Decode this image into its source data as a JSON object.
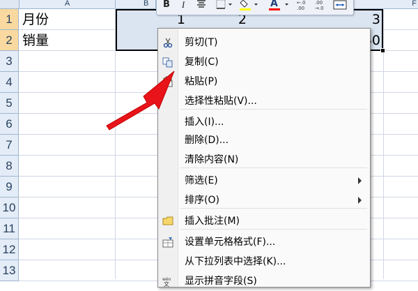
{
  "columns": [
    "A",
    "B",
    "F"
  ],
  "rows": [
    "1",
    "2",
    "3",
    "4",
    "5",
    "6",
    "7",
    "8",
    "9",
    "10",
    "11",
    "12",
    "13"
  ],
  "cells": {
    "a1": "月份",
    "a2": "销量",
    "b1": "1",
    "c1": "2",
    "f1": "3",
    "f2": "60"
  },
  "mini_toolbar": {
    "bold": "B",
    "italic": "I",
    "font_color_letter": "A",
    "fill_color": "#ffff00",
    "font_color": "#ff0000"
  },
  "context_menu": {
    "items": [
      {
        "label": "剪切(T)",
        "icon": "scissors-icon"
      },
      {
        "label": "复制(C)",
        "icon": "copy-icon"
      },
      {
        "label": "粘贴(P)",
        "icon": "paste-icon"
      },
      {
        "label": "选择性粘贴(V)...",
        "icon": ""
      },
      {
        "label": "插入(I)...",
        "icon": ""
      },
      {
        "label": "删除(D)...",
        "icon": ""
      },
      {
        "label": "清除内容(N)",
        "icon": ""
      },
      {
        "label": "筛选(E)",
        "icon": "",
        "submenu": true
      },
      {
        "label": "排序(O)",
        "icon": "",
        "submenu": true
      },
      {
        "label": "插入批注(M)",
        "icon": "insert-comment-icon"
      },
      {
        "label": "设置单元格格式(F)...",
        "icon": "format-cells-icon"
      },
      {
        "label": "从下拉列表中选择(K)...",
        "icon": ""
      },
      {
        "label": "显示拼音字段(S)",
        "icon": "phonetic-icon"
      }
    ]
  },
  "annotation": {
    "arrow_color": "#e8141a"
  }
}
